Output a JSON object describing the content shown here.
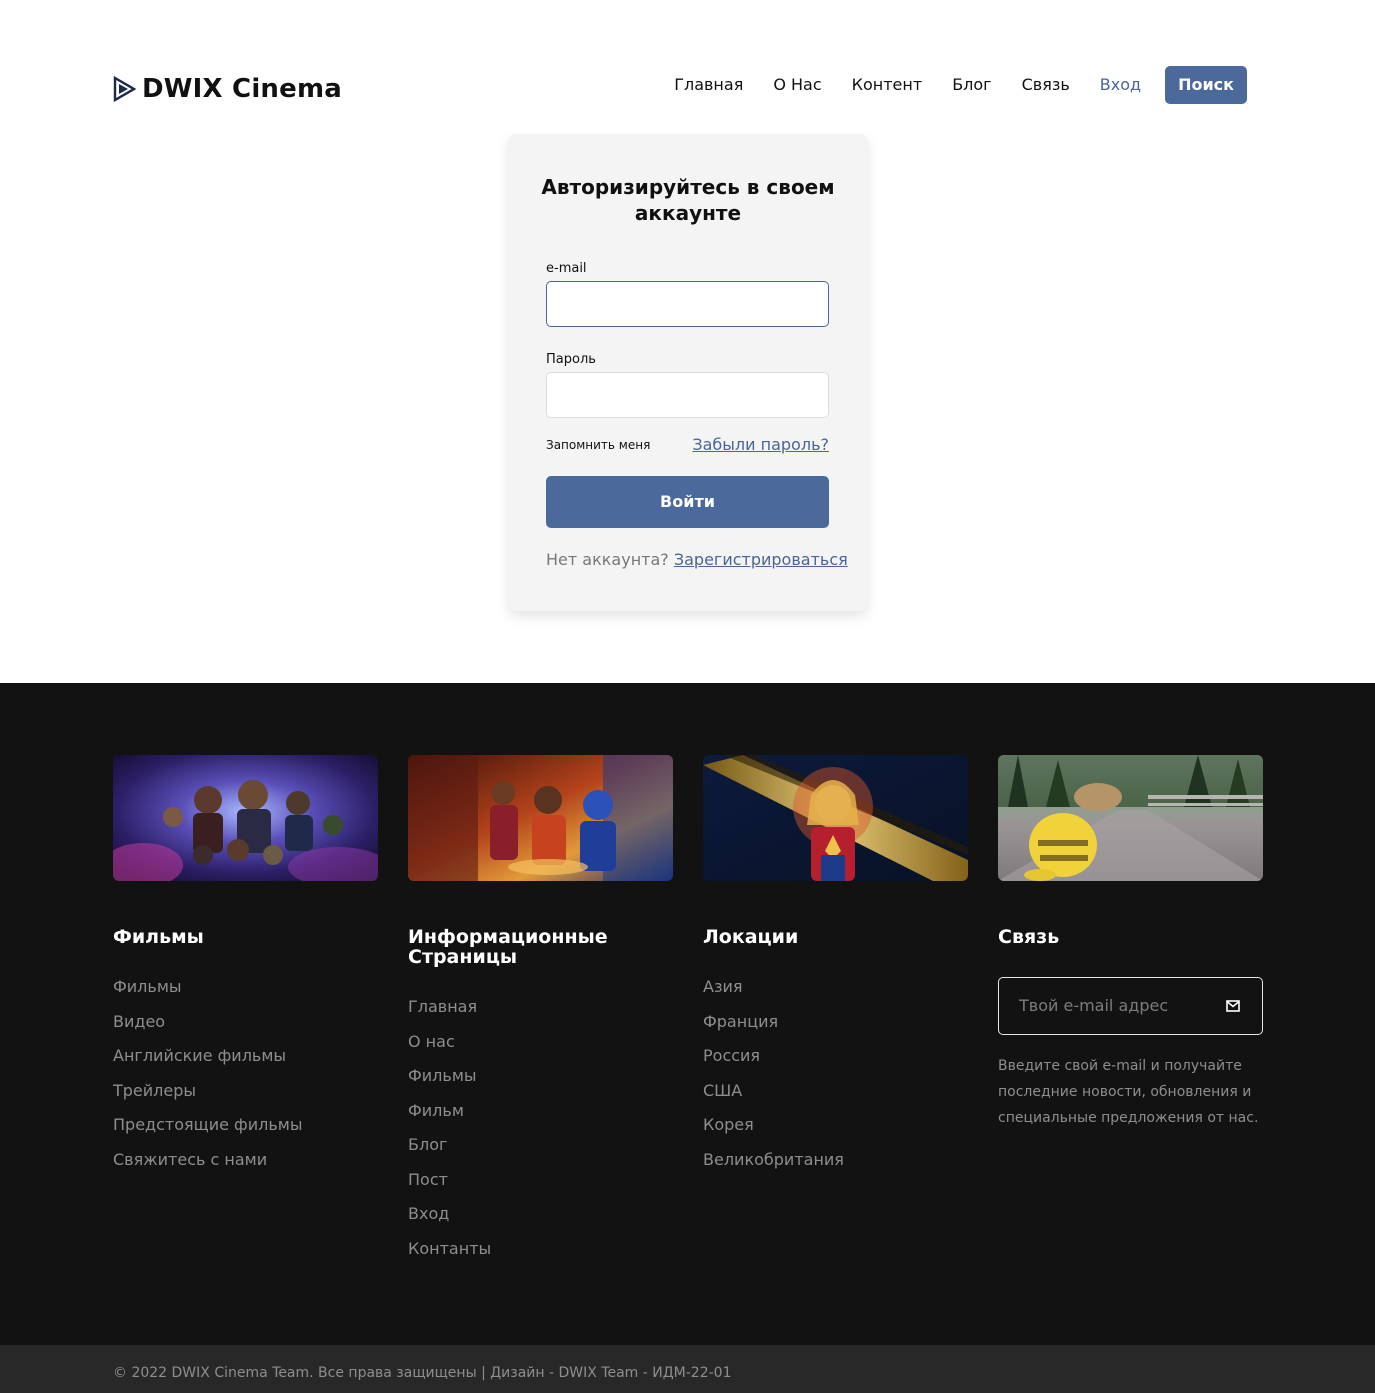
{
  "brand": {
    "name": "DWIX Cinema"
  },
  "nav": {
    "items": [
      "Главная",
      "О Нас",
      "Контент",
      "Блог",
      "Связь"
    ],
    "login": "Вход",
    "search": "Поиск"
  },
  "login_card": {
    "title": "Авторизируйтесь в своем аккаунте",
    "email_label": "e-mail",
    "password_label": "Пароль",
    "remember": "Запомнить меня",
    "forgot": "Забыли пароль?",
    "submit": "Войти",
    "no_account": "Нет аккаунта?",
    "register": "Зарегистрироваться"
  },
  "footer": {
    "films": {
      "title": "Фильмы",
      "items": [
        "Фильмы",
        "Видео",
        "Английские фильмы",
        "Трейлеры",
        "Предстоящие фильмы",
        "Свяжитесь с нами"
      ]
    },
    "info": {
      "title": "Информационные Страницы",
      "items": [
        "Главная",
        "О нас",
        "Фильмы",
        "Фильм",
        "Блог",
        "Пост",
        "Вход",
        "Контанты"
      ]
    },
    "locations": {
      "title": "Локации",
      "items": [
        "Азия",
        "Франция",
        "Россия",
        "США",
        "Корея",
        "Великобритания"
      ]
    },
    "contact": {
      "title": "Связь",
      "placeholder": "Твой e-mail адрес",
      "note": "Введите свой e-mail и получайте последние новости, обновления и специальные предложения от нас."
    },
    "copyright": "© 2022 DWIX Cinema Team. Все права защищены | Дизайн - DWIX Team - ИДМ-22-01"
  },
  "colors": {
    "accent": "#4b6a9b",
    "footer_bg": "#131213",
    "bottom_bar": "#282828"
  },
  "icons": [
    "play-logo-icon",
    "mail-icon"
  ]
}
